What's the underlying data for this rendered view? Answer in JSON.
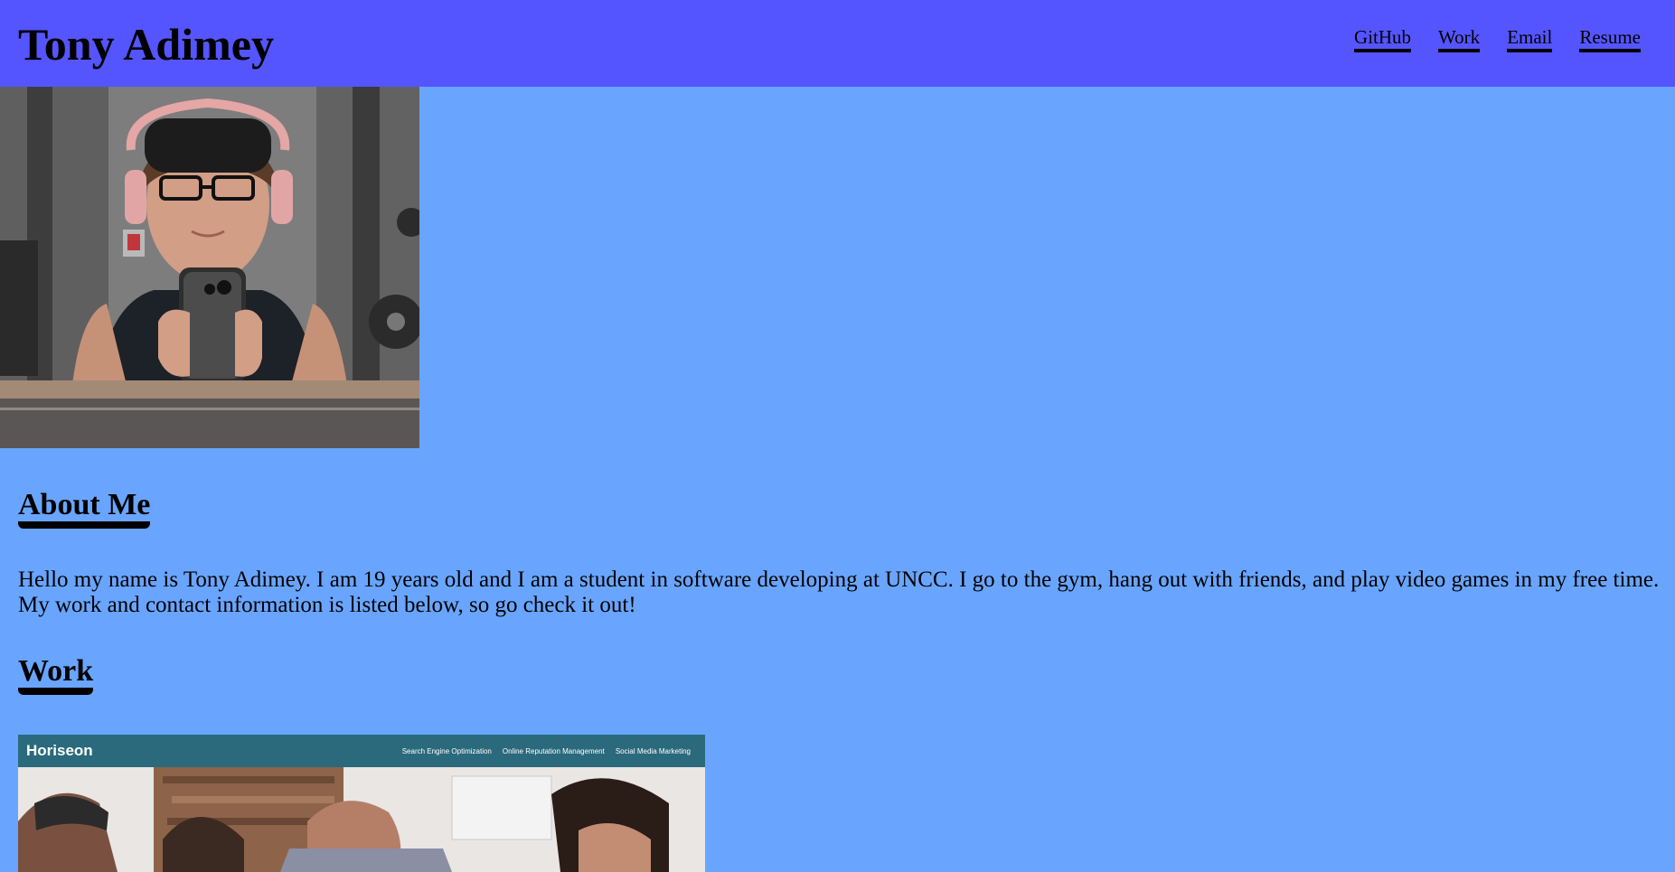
{
  "header": {
    "title": "Tony Adimey",
    "nav": [
      {
        "label": "GitHub"
      },
      {
        "label": "Work"
      },
      {
        "label": "Email"
      },
      {
        "label": "Resume"
      }
    ]
  },
  "about": {
    "heading": "About Me",
    "text": "Hello my name is Tony Adimey. I am 19 years old and I am a student in software developing at UNCC. I go to the gym, hang out with friends, and play video games in my free time. My work and contact information is listed below, so go check it out!"
  },
  "work": {
    "heading": "Work",
    "project_thumbnail": {
      "site_logo": "Horiseon",
      "site_nav": [
        "Search Engine Optimization",
        "Online Reputation Management",
        "Social Media Marketing"
      ]
    }
  },
  "colors": {
    "header_bg": "#5555ff",
    "page_bg": "#69a5fe",
    "thumbnail_bar": "#2a6a7c"
  }
}
